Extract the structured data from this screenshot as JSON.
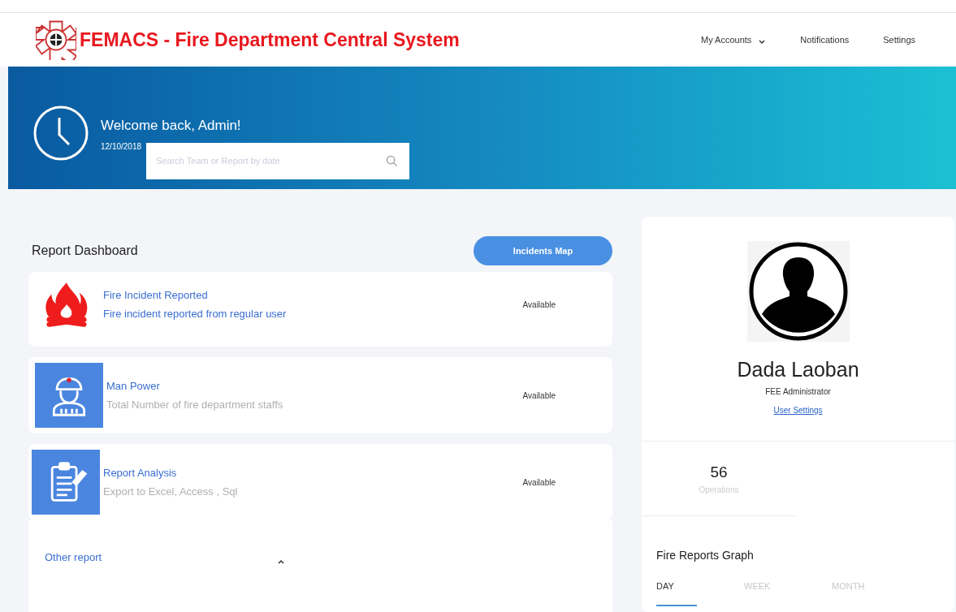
{
  "header": {
    "title": "FEMACS - Fire Department Central System",
    "nav": [
      {
        "label": "My Accounts",
        "dropdown": true
      },
      {
        "label": "Notifications",
        "dropdown": false
      },
      {
        "label": "Settings",
        "dropdown": false
      }
    ]
  },
  "banner": {
    "greeting": "Welcome back, Admin!",
    "date": "12/10/2018",
    "search": {
      "placeholder": "Search Team or Report by date"
    }
  },
  "dashboard": {
    "title": "Report Dashboard",
    "map_button": "Incidents Map",
    "reports": [
      {
        "kind": "fire",
        "title": "Fire Incident Reported",
        "subtitle": "Fire incident reported from regular user",
        "status": "Available"
      },
      {
        "kind": "staff",
        "title": "Man Power",
        "subtitle": "Total Number of fire department staffs",
        "status": "Available"
      },
      {
        "kind": "analysis",
        "title": "Report Analysis",
        "subtitle": "Export to Excel, Access , Sql",
        "status": "Available"
      }
    ],
    "other": {
      "label": "Other report",
      "expanded": true
    }
  },
  "profile": {
    "name": "Dada Laoban",
    "role": "FEE Administrator",
    "link": "User Settings",
    "stat": {
      "value": "56",
      "label": "Operations"
    },
    "graph": {
      "title": "Fire Reports Graph",
      "tabs": [
        {
          "label": "DAY",
          "selected": true
        },
        {
          "label": "WEEK",
          "selected": false
        },
        {
          "label": "MONTH",
          "selected": false
        }
      ]
    }
  }
}
